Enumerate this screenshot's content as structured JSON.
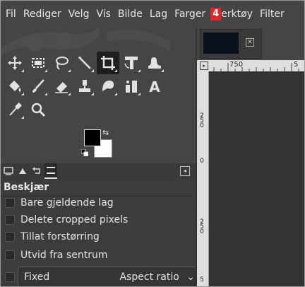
{
  "menubar": {
    "items": [
      "Fil",
      "Rediger",
      "Velg",
      "Vis",
      "Bilde",
      "Lag",
      "Farger"
    ],
    "badge": "4",
    "verktoy": "erktøy",
    "filter": "Filter"
  },
  "tool_options": {
    "title": "Beskjær",
    "options": [
      {
        "label": "Bare gjeldende lag",
        "checked": false
      },
      {
        "label": "Delete cropped pixels",
        "checked": false
      },
      {
        "label": "Tillat forstørring",
        "checked": false
      },
      {
        "label": "Utvid fra sentrum",
        "checked": false
      }
    ],
    "fixed_label": "Fixed",
    "fixed_select": "Aspect ratio",
    "fixed_checked": false
  },
  "ruler": {
    "h_labels": [
      "750",
      "5"
    ],
    "v_labels": [
      "250",
      "0",
      "250",
      "5"
    ]
  },
  "colors": {
    "foreground": "#000000",
    "background": "#ffffff",
    "badge": "#e0262a"
  },
  "tools": [
    "move-icon",
    "rect-select-icon",
    "lasso-icon",
    "fuzzy-select-icon",
    "crop-icon",
    "transform-icon",
    "warp-icon",
    "smudge-icon",
    "bucket-fill-icon",
    "paintbrush-icon",
    "eraser-icon",
    "clone-icon",
    "heal-icon",
    "path-icon",
    "text-icon",
    "color-picker-icon",
    "zoom-icon"
  ]
}
